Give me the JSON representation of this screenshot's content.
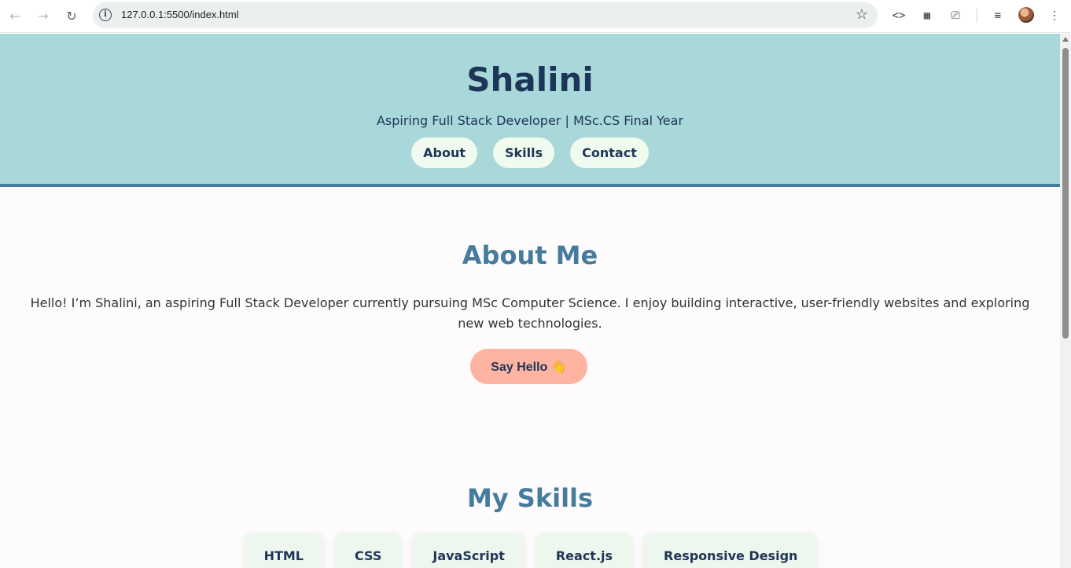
{
  "browser": {
    "url": "127.0.0.1:5500/index.html"
  },
  "hero": {
    "name": "Shalini",
    "tagline": "Aspiring Full Stack Developer | MSc.CS Final Year",
    "nav": [
      "About",
      "Skills",
      "Contact"
    ]
  },
  "about": {
    "title": "About Me",
    "text": "Hello! I’m Shalini, an aspiring Full Stack Developer currently pursuing MSc Computer Science. I enjoy building interactive, user-friendly websites and exploring new web technologies.",
    "button": "Say Hello 👋"
  },
  "skills": {
    "title": "My Skills",
    "items": [
      "HTML",
      "CSS",
      "JavaScript",
      "React.js",
      "Responsive Design"
    ]
  },
  "colors": {
    "hero_bg": "#a8d8da",
    "hero_border": "#457b9d",
    "heading": "#457b9d",
    "button": "#ffb4a2"
  }
}
